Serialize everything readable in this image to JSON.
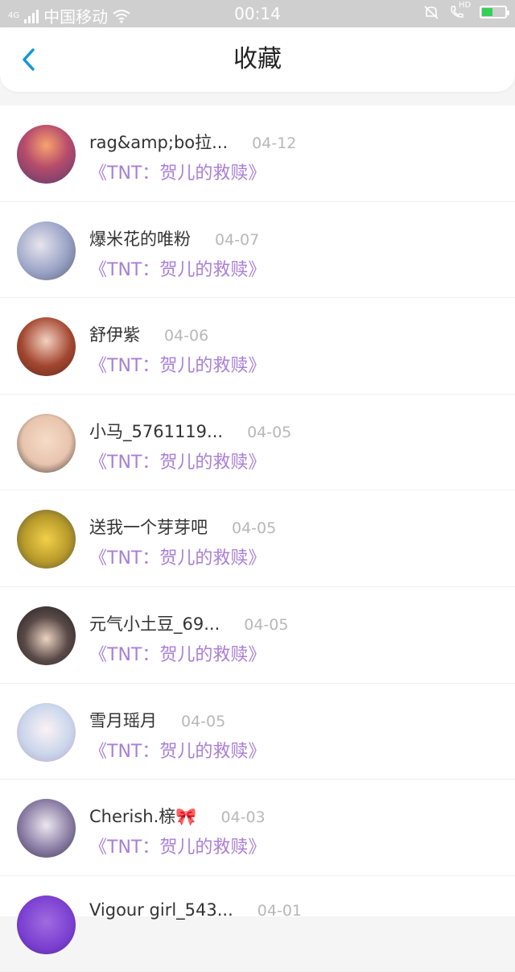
{
  "status_bar": {
    "carrier": "中国移动",
    "time": "00:14",
    "hd_label": "HD",
    "signal_label": "4G",
    "battery_level": 0.45
  },
  "header": {
    "title": "收藏",
    "back_icon": "chevron-left-icon"
  },
  "colors": {
    "accent": "#1296db",
    "book_title": "#a97fd6",
    "date": "#b8b8b8"
  },
  "items": [
    {
      "name": "rag&amp;bo拉...",
      "date": "04-12",
      "book": "《TNT：贺儿的救赎》"
    },
    {
      "name": "爆米花的唯粉",
      "date": "04-07",
      "book": "《TNT：贺儿的救赎》"
    },
    {
      "name": "舒伊紫",
      "date": "04-06",
      "book": "《TNT：贺儿的救赎》"
    },
    {
      "name": "小马_5761119...",
      "date": "04-05",
      "book": "《TNT：贺儿的救赎》"
    },
    {
      "name": "送我一个芽芽吧",
      "date": "04-05",
      "book": "《TNT：贺儿的救赎》"
    },
    {
      "name": "元气小土豆_69...",
      "date": "04-05",
      "book": "《TNT：贺儿的救赎》"
    },
    {
      "name": "雪月瑶月",
      "date": "04-05",
      "book": "《TNT：贺儿的救赎》"
    },
    {
      "name": "Cherish.榇🎀",
      "date": "04-03",
      "book": "《TNT：贺儿的救赎》"
    },
    {
      "name": "Vigour girl_543...",
      "date": "04-01",
      "book": ""
    }
  ]
}
